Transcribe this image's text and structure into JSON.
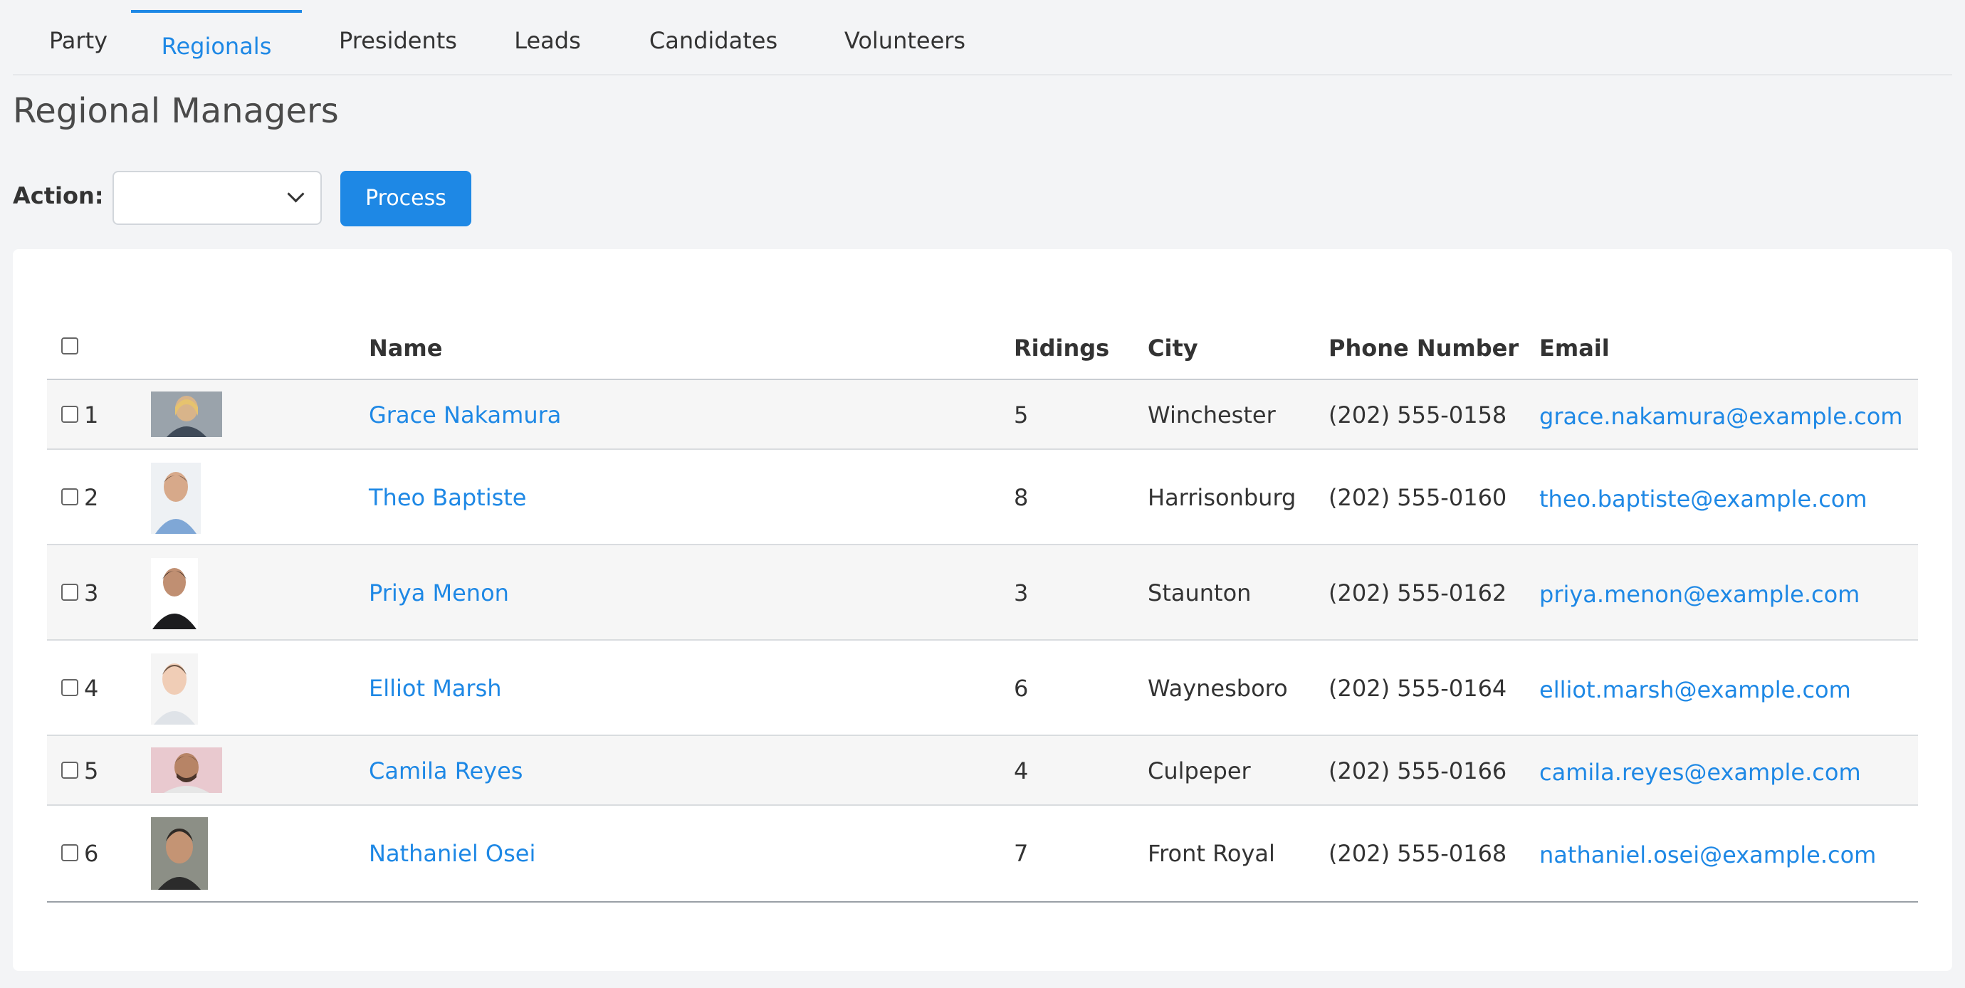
{
  "tabs": [
    {
      "label": "Party",
      "active": false
    },
    {
      "label": "Regionals",
      "active": true
    },
    {
      "label": "Presidents",
      "active": false
    },
    {
      "label": "Leads",
      "active": false
    },
    {
      "label": "Candidates",
      "active": false
    },
    {
      "label": "Volunteers",
      "active": false
    }
  ],
  "page_title": "Regional Managers",
  "action": {
    "label": "Action:",
    "selected_value": "",
    "process_label": "Process"
  },
  "table": {
    "columns": [
      "",
      "",
      "",
      "Name",
      "Ridings",
      "City",
      "Phone Number",
      "Email"
    ],
    "rows": [
      {
        "index": "1",
        "name": "Grace Nakamura",
        "ridings": "5",
        "city": "Winchester",
        "phone": "(202) 555-0158",
        "email": "grace.nakamura@example.com"
      },
      {
        "index": "2",
        "name": "Theo Baptiste",
        "ridings": "8",
        "city": "Harrisonburg",
        "phone": "(202) 555-0160",
        "email": "theo.baptiste@example.com"
      },
      {
        "index": "3",
        "name": "Priya Menon",
        "ridings": "3",
        "city": "Staunton",
        "phone": "(202) 555-0162",
        "email": "priya.menon@example.com"
      },
      {
        "index": "4",
        "name": "Elliot Marsh",
        "ridings": "6",
        "city": "Waynesboro",
        "phone": "(202) 555-0164",
        "email": "elliot.marsh@example.com"
      },
      {
        "index": "5",
        "name": "Camila Reyes",
        "ridings": "4",
        "city": "Culpeper",
        "phone": "(202) 555-0166",
        "email": "camila.reyes@example.com"
      },
      {
        "index": "6",
        "name": "Nathaniel Osei",
        "ridings": "7",
        "city": "Front Royal",
        "phone": "(202) 555-0168",
        "email": "nathaniel.osei@example.com"
      }
    ]
  },
  "colors": {
    "accent": "#1e88e5",
    "page_bg": "#f3f4f6",
    "row_alt": "#f6f6f6"
  }
}
